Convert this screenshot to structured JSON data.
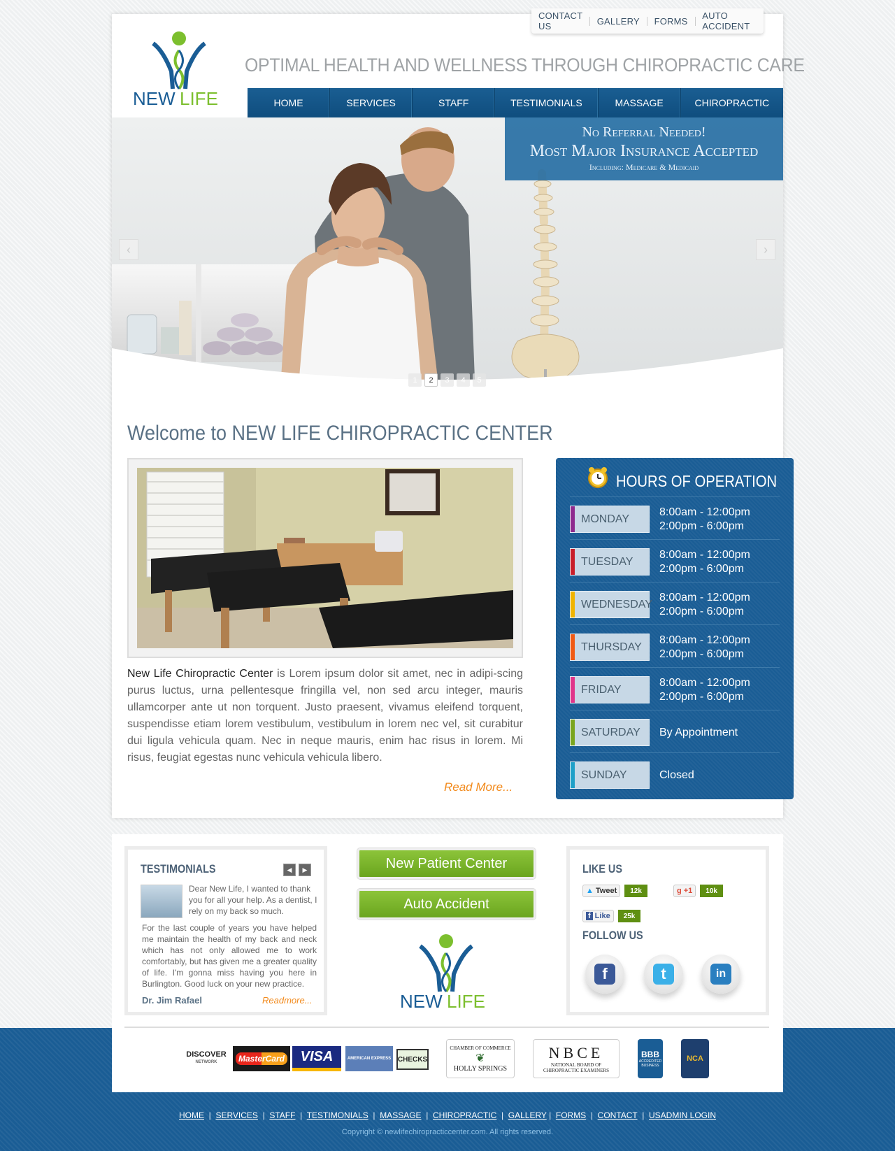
{
  "top_links": [
    "CONTACT US",
    "GALLERY",
    "FORMS",
    "AUTO ACCIDENT"
  ],
  "logo": {
    "word1": "NEW",
    "word2": "LIFE"
  },
  "tagline": "OPTIMAL HEALTH AND WELLNESS THROUGH CHIROPRACTIC CARE",
  "nav": [
    "HOME",
    "SERVICES",
    "STAFF",
    "TESTIMONIALS",
    "MASSAGE",
    "CHIROPRACTIC"
  ],
  "banner": {
    "line1": "No Referral Needed!",
    "line2": "Most Major Insurance Accepted",
    "line3": "Including: Medicare & Medicaid"
  },
  "slider": {
    "prev": "‹",
    "next": "›",
    "dots": [
      "1",
      "2",
      "3",
      "4",
      "5"
    ],
    "active": "2"
  },
  "welcome_title": "Welcome to NEW LIFE CHIROPRACTIC CENTER",
  "intro": {
    "lead": "New Life Chiropractic Center",
    "body": " is Lorem ipsum dolor sit amet, nec in adipi-scing purus luctus, urna pellentesque fringilla vel, non sed arcu integer, mauris ullamcorper ante ut non torquent. Justo praesent, vivamus eleifend torquent, suspendisse etiam lorem vestibulum, vestibulum in lorem nec vel, sit curabitur dui ligula vehicula quam. Nec in neque mauris, enim hac risus in lorem. Mi risus, feugiat egestas nunc vehicula vehicula libero."
  },
  "read_more": "Read More...",
  "hours": {
    "title": "HOURS OF OPERATION",
    "days": [
      {
        "day": "MONDAY",
        "l1": "8:00am - 12:00pm",
        "l2": "2:00pm - 6:00pm",
        "color": "#8e2a8e"
      },
      {
        "day": "TUESDAY",
        "l1": "8:00am - 12:00pm",
        "l2": "2:00pm - 6:00pm",
        "color": "#c81e2a"
      },
      {
        "day": "WEDNESDAY",
        "l1": "8:00am - 12:00pm",
        "l2": "2:00pm - 6:00pm",
        "color": "#f0b400"
      },
      {
        "day": "THURSDAY",
        "l1": "8:00am - 12:00pm",
        "l2": "2:00pm - 6:00pm",
        "color": "#f05a14"
      },
      {
        "day": "FRIDAY",
        "l1": "8:00am - 12:00pm",
        "l2": "2:00pm - 6:00pm",
        "color": "#e0358a"
      },
      {
        "day": "SATURDAY",
        "l1": "By Appointment",
        "l2": "",
        "color": "#7aa51e"
      },
      {
        "day": "SUNDAY",
        "l1": "Closed",
        "l2": "",
        "color": "#1ea0c8"
      }
    ]
  },
  "testimonials": {
    "title": "TESTIMONIALS",
    "prev": "◀",
    "next": "▶",
    "text1": "Dear New Life, I wanted to thank you for all your help. As a dentist, I rely on my back so much.",
    "text2": "For the last couple of years you have helped me maintain the health of my back and neck which has not only allowed me to work comfortably, but has given me a greater quality of life. I'm gonna miss having you here in Burlington. Good luck on your new practice.",
    "author": "Dr. Jim Rafael",
    "readmore": "Readmore..."
  },
  "buttons": {
    "new_patient": "New Patient Center",
    "auto_accident": "Auto Accident"
  },
  "social": {
    "like_title": "LIKE US",
    "follow_title": "FOLLOW US",
    "tweet": "Tweet",
    "tweet_count": "12k",
    "gplus": "+1",
    "gplus_count": "10k",
    "like": "Like",
    "like_count": "25k",
    "icons": [
      "f",
      "t",
      "in"
    ]
  },
  "payments": {
    "discover": "DISCOVER",
    "discover_sub": "NETWORK",
    "mastercard": "MasterCard",
    "visa": "VISA",
    "amex": "AMERICAN EXPRESS",
    "checks": "CHECKS"
  },
  "assoc": {
    "chamber": "CHAMBER OF COMMERCE",
    "holly": "HOLLY SPRINGS",
    "nbce": "NBCE",
    "nbce_sub": "NATIONAL BOARD OF CHIROPRACTIC EXAMINERS",
    "bbb": "BBB",
    "bbb_sub": "ACCREDITED BUSINESS",
    "nca": "NCA"
  },
  "footer_links": [
    "HOME",
    "SERVICES",
    "STAFF",
    "TESTIMONIALS",
    "MASSAGE",
    "CHIROPRACTIC",
    "GALLERY",
    "FORMS",
    "CONTACT",
    "USADMIN LOGIN"
  ],
  "copyright": "Copyright © newlifechiropracticcenter.com. All rights reserved."
}
